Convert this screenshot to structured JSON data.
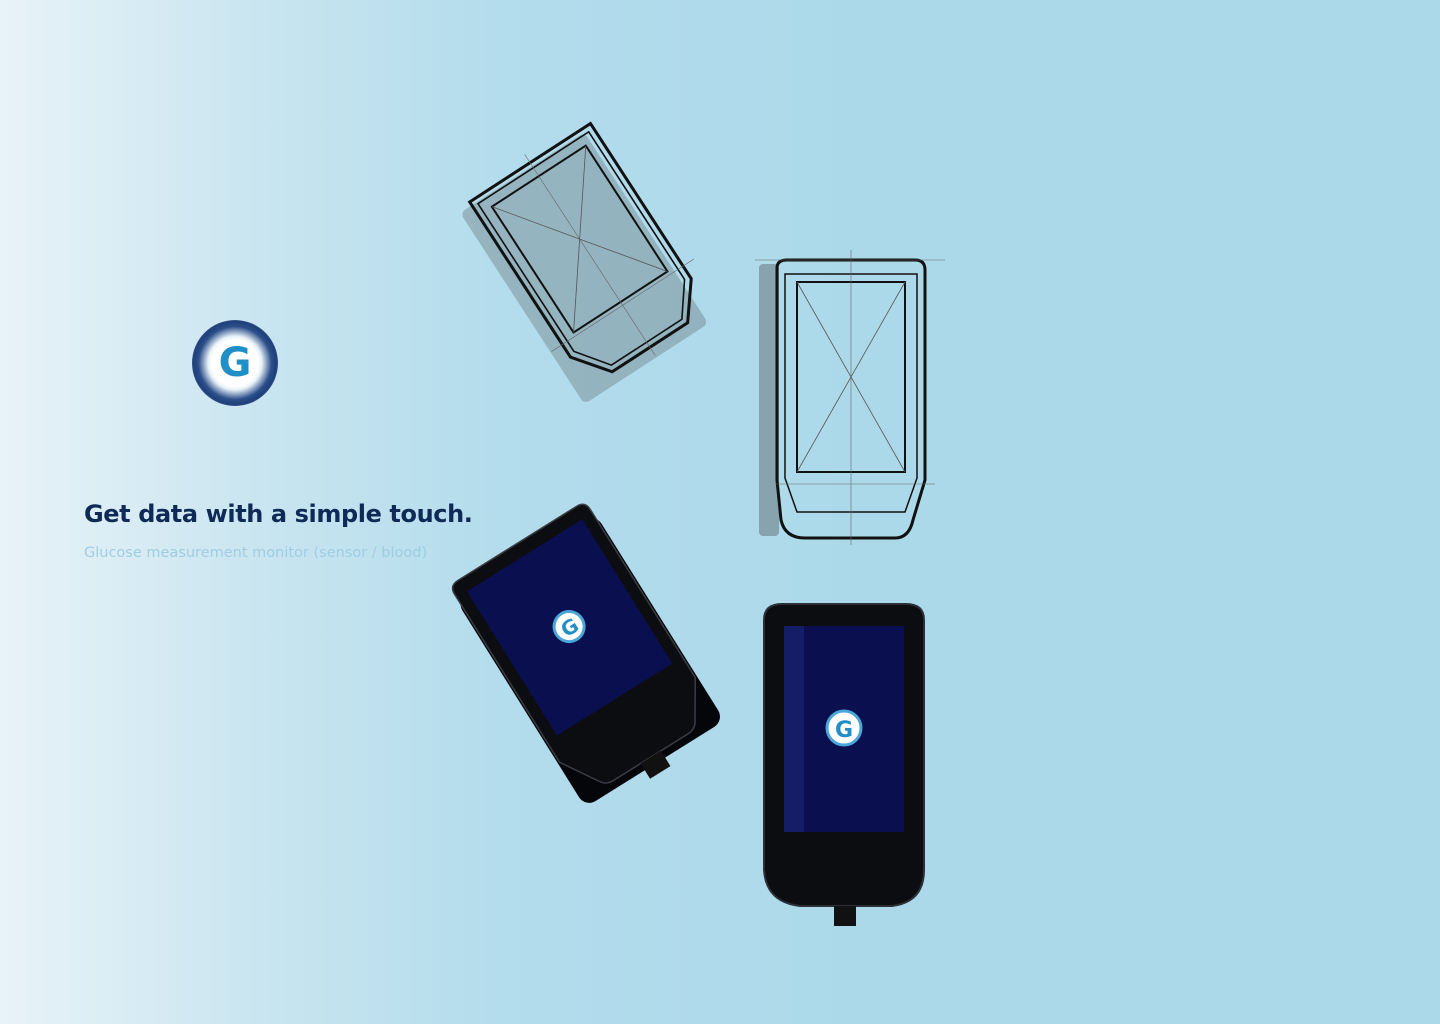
{
  "hero": {
    "logo_letter": "G",
    "headline": "Get data with a simple touch.",
    "subline": "Glucose measurement monitor (sensor / blood)"
  },
  "devices": {
    "screen_logo_letter": "G"
  },
  "icons": {
    "brand_logo": "g-logo-icon"
  },
  "colors": {
    "background": "#acd9ea",
    "headline": "#0f2a57",
    "subline": "#9fcde3",
    "screen": "#0a0f50",
    "device_body": "#0c0d10",
    "logo_accent": "#1f8fc6"
  }
}
